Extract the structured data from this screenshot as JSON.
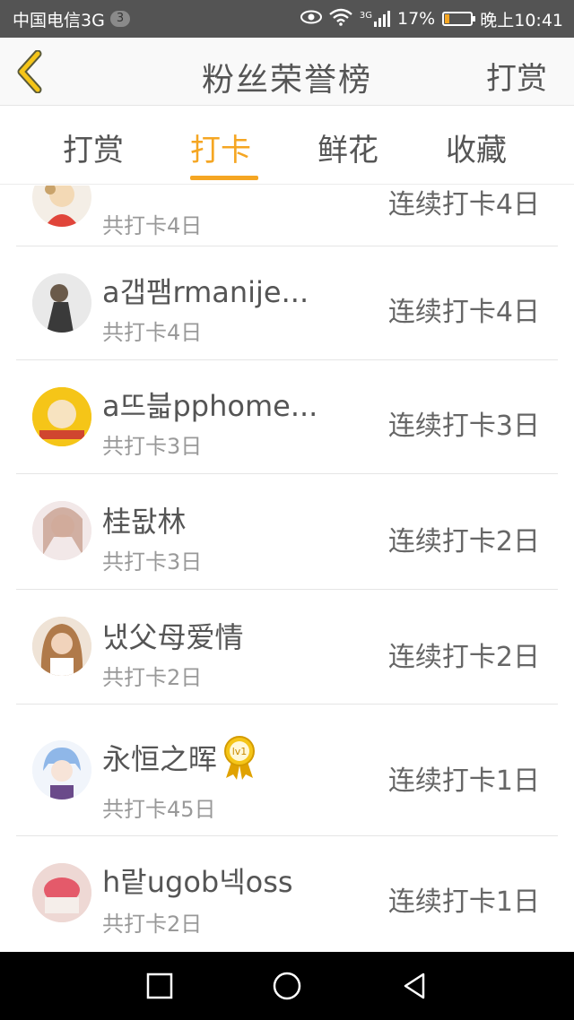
{
  "status_bar": {
    "carrier": "中国电信3G",
    "sim_badge": "3",
    "network": "3G",
    "battery": "17%",
    "battery_level": 0.17,
    "time": "晚上10:41"
  },
  "header": {
    "title": "粉丝荣誉榜",
    "action_label": "打赏"
  },
  "tabs": [
    {
      "label": "打赏",
      "active": false
    },
    {
      "label": "打卡",
      "active": true
    },
    {
      "label": "鲜花",
      "active": false
    },
    {
      "label": "收藏",
      "active": false
    }
  ],
  "list": [
    {
      "name": "a갭팸rmanije...",
      "total": "共打卡4日",
      "streak": "连续打卡4日"
    },
    {
      "name": "a뜨븗pphome...",
      "total": "共打卡3日",
      "streak": "连续打卡3日"
    },
    {
      "name": "桂돲林",
      "total": "共打卡3日",
      "streak": "连续打卡2日"
    },
    {
      "name": "냈父母爱情",
      "total": "共打卡2日",
      "streak": "连续打卡2日"
    },
    {
      "name": "永恒之晖",
      "badge": "lv1",
      "total": "共打卡45日",
      "streak": "连续打卡1日"
    },
    {
      "name": "h랕ugob넥oss",
      "total": "共打卡2日",
      "streak": "连续打卡1日"
    }
  ],
  "partial_row": {
    "total": "共打卡4日",
    "streak": "连续打卡4日"
  },
  "colors": {
    "accent": "#f5a623",
    "status_bar": "#545454",
    "nav_bar": "#000000"
  }
}
